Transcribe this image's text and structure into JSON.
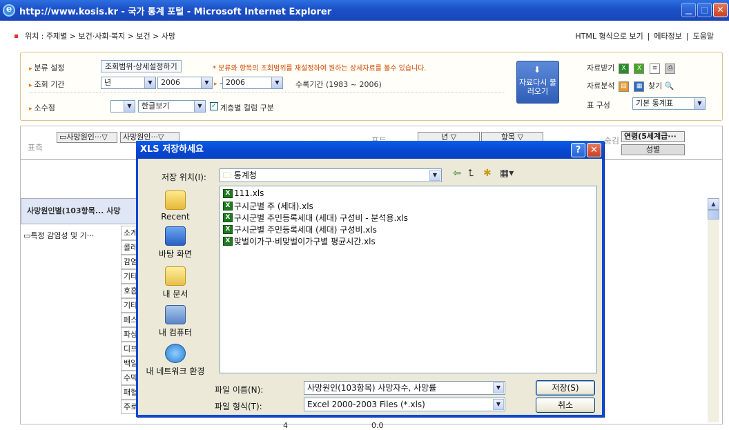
{
  "window": {
    "title": "http://www.kosis.kr - 국가 통계 포털 - Microsoft Internet Explorer"
  },
  "breadcrumb": {
    "text": "위치 : 주제별 > 보건·사회·복지 > 보건 > 사망"
  },
  "top_links": {
    "html_view": "HTML 형식으로 보기",
    "sep": "|",
    "meta": "메타정보",
    "sep2": "|",
    "help": "도움말"
  },
  "settings": {
    "classify_label": "분류 설정",
    "classify_button": "조회범위·상세설정하기",
    "classify_hint": "* 분류와 항목의 조회범위를 재설정하여 원하는 상세자료를 볼수 있습니다.",
    "period_label": "조회 기간",
    "period_unit": "년",
    "period_from": "2006",
    "period_tilde": "~",
    "period_to": "2006",
    "collect_period": "수록기간 (1983 ~ 2006)",
    "decimal_label": "소수점",
    "decimal_value": "",
    "view_mode": "한글보기",
    "hier_checkbox_label": "계층별 컬럼 구분",
    "reload_button": "자료다시 불러오기",
    "download_label": "자료받기",
    "analysis_label": "자료분석",
    "find_label": "찾기",
    "table_struct_label": "표 구성",
    "table_struct_value": "기본 통계표"
  },
  "pivot": {
    "row_label": "표측",
    "row_chip1": "▭사망원인···▽",
    "row_chip2": "사망원인···▽",
    "col_chip1": "년",
    "col_chip2": "항목",
    "col_label": "표두",
    "hidden_label": "숨김",
    "hidden_chip1": "연령(5세계급···",
    "hidden_chip2": "성별"
  },
  "grid": {
    "header1": "사망원인별(103항목...",
    "header2": "사망",
    "group_row": "▭특정 감염성 및 기···",
    "sub_rows": [
      "소계",
      "콜레",
      "감염",
      "기타",
      "호흡",
      "기타",
      "페스",
      "파상",
      "디프",
      "백일",
      "수막",
      "패혈",
      "주로 성행위로 전파"
    ],
    "last_values": [
      "4",
      "0.0"
    ]
  },
  "dialog": {
    "title": "XLS 저장하세요",
    "save_in_label": "저장 위치(I):",
    "save_in_value": "통계청",
    "places": [
      "Recent",
      "바탕 화면",
      "내 문서",
      "내 컴퓨터",
      "내 네트워크 환경"
    ],
    "files": [
      "111.xls",
      "구시군별 주 (세대).xls",
      "구시군별 주민등록세대 (세대) 구성비 - 분석용.xls",
      "구시군별 주민등록세대 (세대) 구성비.xls",
      "맞벌이가구·비맞벌이가구별 평균시간.xls"
    ],
    "filename_label": "파일 이름(N):",
    "filename_value": "사망원인(103항목) 사망자수, 사망률",
    "filetype_label": "파일 형식(T):",
    "filetype_value": "Excel 2000-2003 Files (*.xls)",
    "save_button": "저장(S)",
    "cancel_button": "취소"
  }
}
